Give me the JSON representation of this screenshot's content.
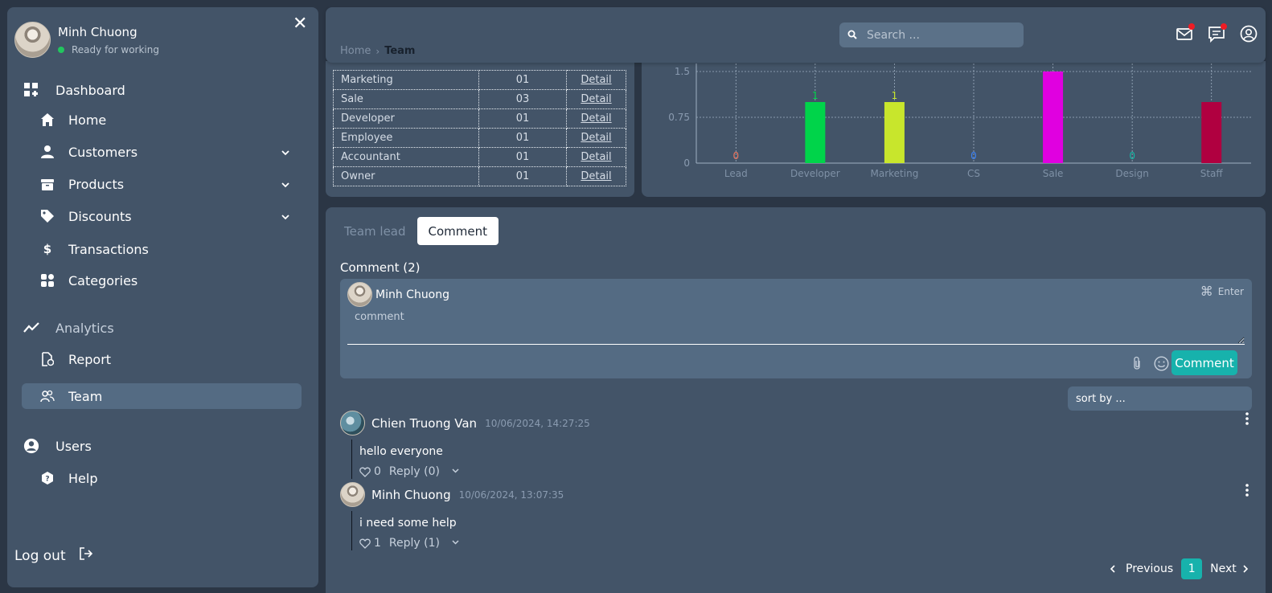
{
  "user": {
    "name": "Minh Chuong",
    "status": "Ready for working"
  },
  "sidebar": {
    "items": [
      {
        "label": "Dashboard"
      },
      {
        "label": "Home"
      },
      {
        "label": "Customers"
      },
      {
        "label": "Products"
      },
      {
        "label": "Discounts"
      },
      {
        "label": "Transactions"
      },
      {
        "label": "Categories"
      },
      {
        "label": "Analytics"
      },
      {
        "label": "Report"
      },
      {
        "label": "Team"
      },
      {
        "label": "Users"
      },
      {
        "label": "Help"
      }
    ],
    "logout": "Log out"
  },
  "header": {
    "breadcrumb": {
      "home": "Home",
      "current": "Team"
    },
    "search_placeholder": "Search ..."
  },
  "team_table": {
    "rows": [
      {
        "role": "Marketing",
        "count": "01",
        "link": "Detail"
      },
      {
        "role": "Sale",
        "count": "03",
        "link": "Detail"
      },
      {
        "role": "Developer",
        "count": "01",
        "link": "Detail"
      },
      {
        "role": "Employee",
        "count": "01",
        "link": "Detail"
      },
      {
        "role": "Accountant",
        "count": "01",
        "link": "Detail"
      },
      {
        "role": "Owner",
        "count": "01",
        "link": "Detail"
      }
    ]
  },
  "chart_data": {
    "type": "bar",
    "categories": [
      "Lead",
      "Developer",
      "Marketing",
      "CS",
      "Sale",
      "Design",
      "Staff"
    ],
    "values": [
      0,
      1,
      1,
      0,
      1.5,
      0,
      1
    ],
    "data_labels": [
      "0",
      "1",
      "1",
      "0",
      "",
      "0",
      ""
    ],
    "colors": [
      "#f07860",
      "#00d44a",
      "#c8e62c",
      "#3b82f6",
      "#e000e0",
      "#14b8a6",
      "#b00040"
    ],
    "y_ticks": [
      "0",
      "0.75",
      "1.5"
    ],
    "ylim": [
      0,
      1.5
    ],
    "grid": true
  },
  "tabs": [
    {
      "label": "Team lead"
    },
    {
      "label": "Comment"
    }
  ],
  "comments_section": {
    "title": "Comment (2)",
    "composer": {
      "author": "Minh Chuong",
      "shortcut": "Enter",
      "placeholder": "comment",
      "submit_label": "Comment"
    },
    "sort_label": "sort by ..."
  },
  "comments": [
    {
      "author": "Chien Truong Van",
      "time": "10/06/2024, 14:27:25",
      "text": "hello everyone",
      "likes": "0",
      "reply": "Reply (0)"
    },
    {
      "author": "Minh Chuong",
      "time": "10/06/2024, 13:07:35",
      "text": "i need some help",
      "likes": "1",
      "reply": "Reply (1)"
    }
  ],
  "pagination": {
    "previous": "Previous",
    "page": "1",
    "next": "Next"
  }
}
